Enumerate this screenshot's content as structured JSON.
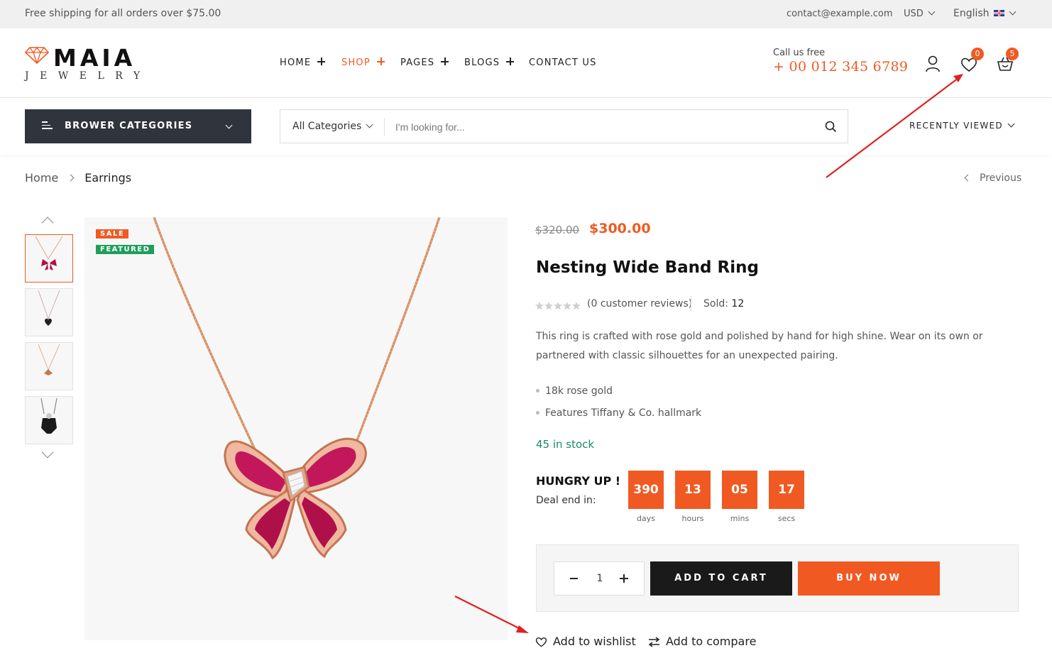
{
  "topbar": {
    "shipping_text": "Free shipping for all orders over $75.00",
    "email": "contact@example.com",
    "currency": "USD",
    "language": "English"
  },
  "logo": {
    "brand": "MAIA",
    "sub": "JEWELRY"
  },
  "nav": {
    "items": [
      {
        "label": "HOME",
        "has_sub": true,
        "active": false
      },
      {
        "label": "SHOP",
        "has_sub": true,
        "active": true
      },
      {
        "label": "PAGES",
        "has_sub": true,
        "active": false
      },
      {
        "label": "BLOGS",
        "has_sub": true,
        "active": false
      },
      {
        "label": "CONTACT US",
        "has_sub": false,
        "active": false
      }
    ]
  },
  "header": {
    "call_label": "Call us free",
    "phone": "+ 00 012 345 6789",
    "wishlist_count": "0",
    "cart_count": "5"
  },
  "catbar": {
    "browse_label": "BROWER CATEGORIES",
    "search_category": "All Categories",
    "search_placeholder": "I'm looking for...",
    "recently_viewed": "RECENTLY VIEWED"
  },
  "breadcrumb": {
    "home": "Home",
    "current": "Earrings",
    "previous": "Previous"
  },
  "gallery": {
    "tags": {
      "sale": "SALE",
      "featured": "FEATURED"
    },
    "thumb_count": 4,
    "selected_thumb": 0
  },
  "product": {
    "old_price": "$320.00",
    "price": "$300.00",
    "title": "Nesting Wide Band Ring",
    "rating": 0,
    "reviews": "(0 customer reviews)",
    "sold_label": "Sold:",
    "sold_value": "12",
    "description": "This ring is crafted with rose gold and polished by hand for high shine. Wear on its own or partnered with classic silhouettes for an unexpected pairing.",
    "features": [
      "18k rose gold",
      "Features Tiffany & Co. hallmark"
    ],
    "stock": "45 in stock",
    "deal": {
      "title": "HUNGRY UP !",
      "label": "Deal end in:",
      "units": [
        {
          "value": "390",
          "label": "days"
        },
        {
          "value": "13",
          "label": "hours"
        },
        {
          "value": "05",
          "label": "mins"
        },
        {
          "value": "17",
          "label": "secs"
        }
      ]
    },
    "quantity": "1",
    "add_to_cart": "ADD TO CART",
    "buy_now": "BUY NOW",
    "add_to_wishlist": "Add to wishlist",
    "add_to_compare": "Add to compare"
  },
  "colors": {
    "accent": "#f05a22",
    "dark": "#2f343d",
    "stock_green": "#1e8a64",
    "featured_green": "#1e9e5a",
    "annotation_red": "#e02020"
  }
}
